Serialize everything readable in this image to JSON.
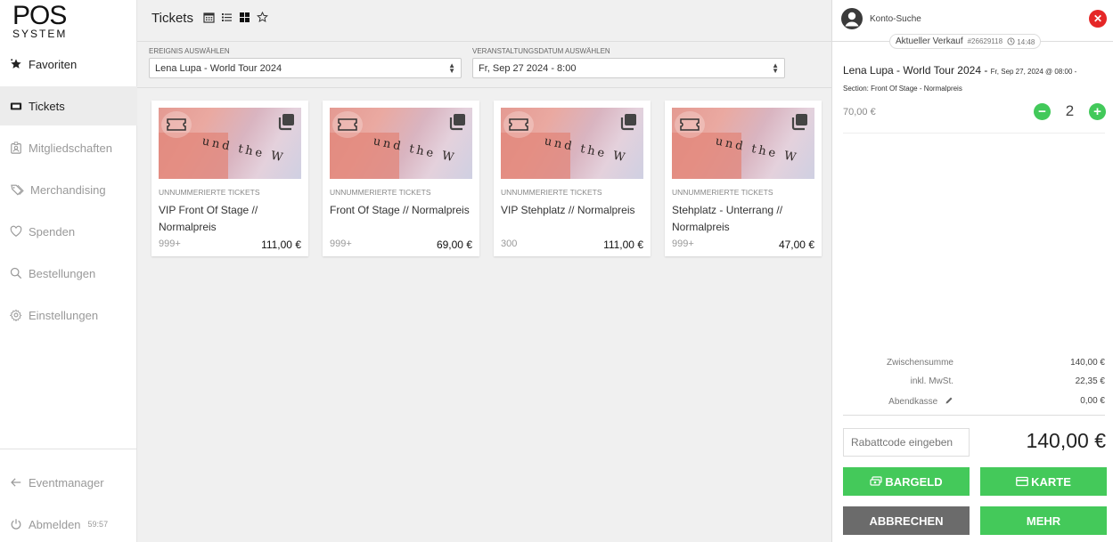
{
  "logo": {
    "line1": "POS",
    "line2": "SYSTEM"
  },
  "sidebar": {
    "items": [
      {
        "label": "Favoriten",
        "icon": "star-icon"
      },
      {
        "label": "Tickets",
        "icon": "ticket-icon"
      },
      {
        "label": "Mitgliedschaften",
        "icon": "membership-icon"
      },
      {
        "label": "Merchandising",
        "icon": "tags-icon"
      },
      {
        "label": "Spenden",
        "icon": "heart-icon"
      },
      {
        "label": "Bestellungen",
        "icon": "search-icon"
      },
      {
        "label": "Einstellungen",
        "icon": "gear-icon"
      }
    ],
    "bottom": [
      {
        "label": "Eventmanager",
        "icon": "arrow-left-icon"
      },
      {
        "label": "Abmelden",
        "icon": "power-icon",
        "timer": "59:57"
      }
    ]
  },
  "main": {
    "title": "Tickets",
    "view_icons": [
      "calendar-icon",
      "list-icon",
      "grid-icon",
      "star-outline-icon"
    ],
    "filters": {
      "event": {
        "label": "EREIGNIS AUSWÄHLEN",
        "value": "Lena Lupa - World Tour 2024"
      },
      "date": {
        "label": "VERANSTALTUNGSDATUM AUSWÄHLEN",
        "value": "Fr, Sep 27 2024 - 8:00"
      }
    },
    "cards": [
      {
        "type": "UNNUMMERIERTE TICKETS",
        "name": "VIP Front Of Stage // Normalpreis",
        "stock": "999+",
        "price": "111,00 €"
      },
      {
        "type": "UNNUMMERIERTE TICKETS",
        "name": "Front Of Stage // Normalpreis",
        "stock": "999+",
        "price": "69,00 €"
      },
      {
        "type": "UNNUMMERIERTE TICKETS",
        "name": "VIP Stehplatz // Normalpreis",
        "stock": "300",
        "price": "111,00 €"
      },
      {
        "type": "UNNUMMERIERTE TICKETS",
        "name": "Stehplatz - Unterrang // Normalpreis",
        "stock": "999+",
        "price": "47,00 €"
      }
    ],
    "card_image_text": "und the W"
  },
  "cart": {
    "account_label": "Konto-Suche",
    "sale_label": "Aktueller Verkauf",
    "sale_id": "#26629118",
    "sale_time": "14:48",
    "item": {
      "title": "Lena Lupa - World Tour 2024 -",
      "date": "Fr, Sep 27, 2024 @ 08:00 -",
      "section": "Section: Front Of Stage - Normalpreis",
      "price": "70,00 €",
      "quantity": "2"
    },
    "summary": {
      "subtotal_label": "Zwischensumme",
      "subtotal": "140,00 €",
      "vat_label": "inkl. MwSt.",
      "vat": "22,35 €",
      "boxoffice_label": "Abendkasse",
      "boxoffice": "0,00 €"
    },
    "coupon_placeholder": "Rabattcode eingeben",
    "total": "140,00 €",
    "buttons": {
      "cash": "BARGELD",
      "card": "KARTE",
      "cancel": "ABBRECHEN",
      "more": "MEHR"
    }
  },
  "colors": {
    "accent_green": "#44c95a",
    "danger_red": "#e52727",
    "cancel_grey": "#6b6b6b"
  }
}
